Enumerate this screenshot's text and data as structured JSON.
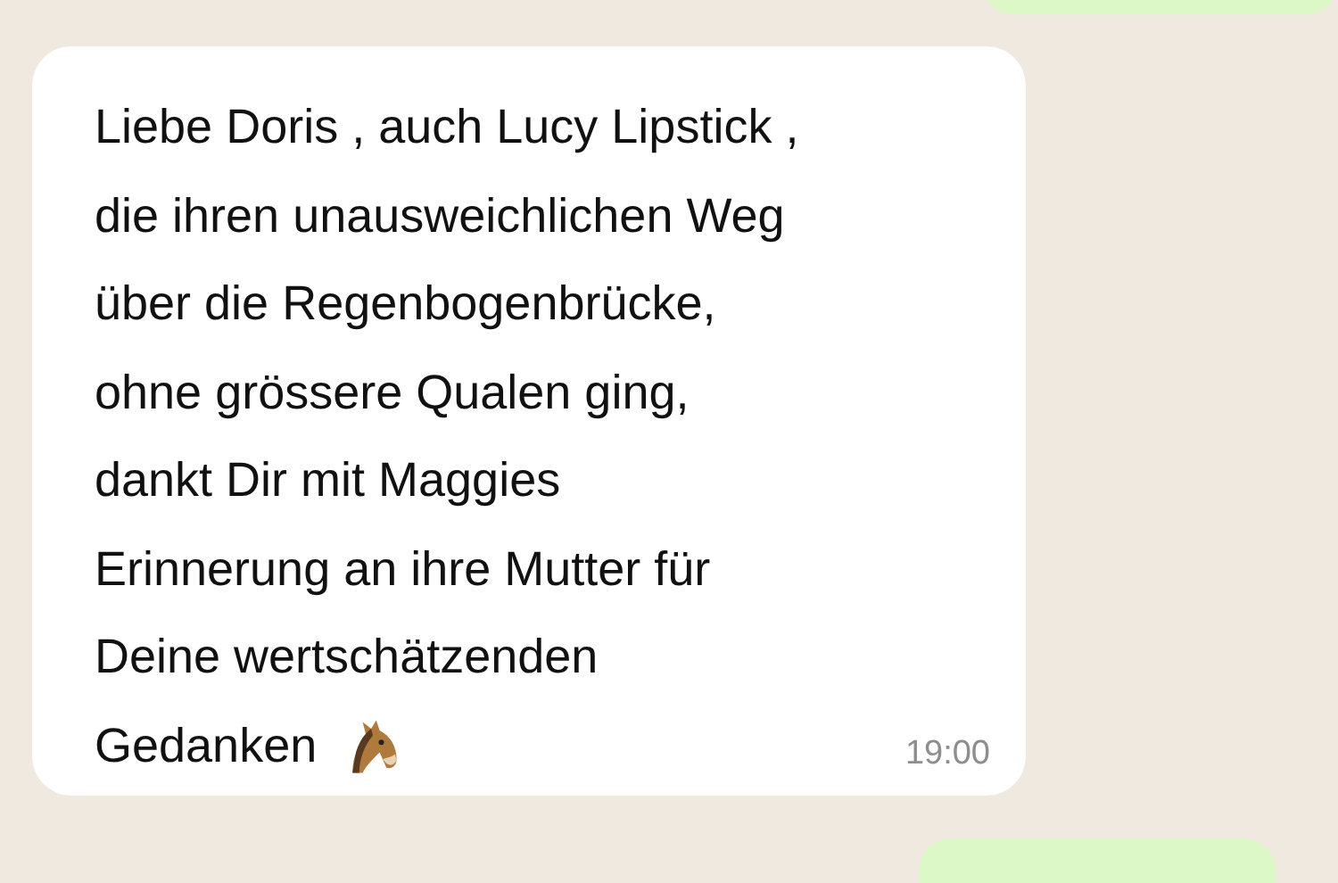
{
  "message": {
    "lines": [
      "Liebe Doris , auch Lucy Lipstick ,",
      "die ihren unausweichlichen Weg",
      "über die Regenbogenbrücke,",
      "ohne grössere Qualen ging,",
      "dankt Dir mit Maggies",
      "Erinnerung an ihre Mutter für",
      "Deine wertschätzenden",
      "Gedanken"
    ],
    "time": "19:00"
  }
}
